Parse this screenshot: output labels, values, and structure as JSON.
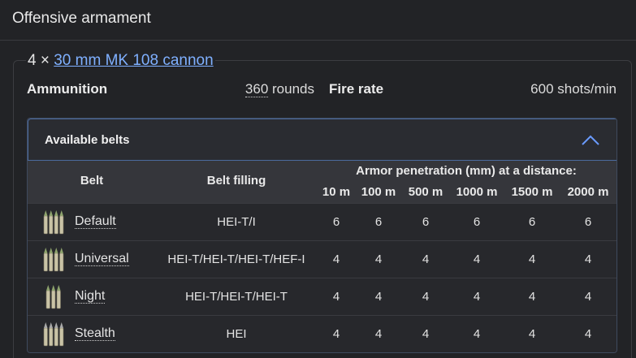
{
  "section": {
    "title": "Offensive armament"
  },
  "weapon": {
    "count_prefix": "4 ×",
    "name": "30 mm MK 108 cannon"
  },
  "stats": {
    "ammunition_label": "Ammunition",
    "ammunition_count": "360",
    "ammunition_unit": "rounds",
    "fire_rate_label": "Fire rate",
    "fire_rate_value": "600 shots/min"
  },
  "belts": {
    "toggle_label": "Available belts",
    "headers": {
      "belt": "Belt",
      "filling": "Belt filling",
      "penetration": "Armor penetration (mm) at a distance:",
      "distances": [
        "10 m",
        "100 m",
        "500 m",
        "1000 m",
        "1500 m",
        "2000 m"
      ]
    },
    "rows": [
      {
        "name": "Default",
        "filling": "HEI-T/I",
        "pen": [
          "6",
          "6",
          "6",
          "6",
          "6",
          "6"
        ],
        "icon": "ammo-belt-4-icon"
      },
      {
        "name": "Universal",
        "filling": "HEI-T/HEI-T/HEI-T/HEF-I",
        "pen": [
          "4",
          "4",
          "4",
          "4",
          "4",
          "4"
        ],
        "icon": "ammo-belt-4-icon"
      },
      {
        "name": "Night",
        "filling": "HEI-T/HEI-T/HEI-T",
        "pen": [
          "4",
          "4",
          "4",
          "4",
          "4",
          "4"
        ],
        "icon": "ammo-belt-3-icon"
      },
      {
        "name": "Stealth",
        "filling": "HEI",
        "pen": [
          "4",
          "4",
          "4",
          "4",
          "4",
          "4"
        ],
        "icon": "ammo-belt-4-icon"
      }
    ]
  },
  "colors": {
    "background": "#222326",
    "link": "#7fb0ff",
    "toggle_border": "#4b6a9e",
    "chevron": "#6a9bff"
  }
}
